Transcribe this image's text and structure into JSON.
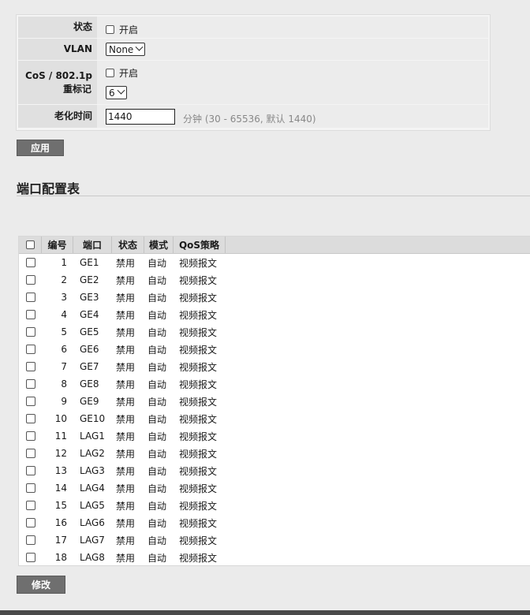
{
  "settings": {
    "status_label": "状态",
    "status_checkbox_text": "开启",
    "vlan_label": "VLAN",
    "vlan_value": "None",
    "cos_label_line1": "CoS / 802.1p",
    "cos_label_line2": "重标记",
    "cos_checkbox_text": "开启",
    "cos_value": "6",
    "aging_label": "老化时间",
    "aging_value": "1440",
    "aging_hint": "分钟 (30 - 65536, 默认 1440)",
    "apply_button": "应用"
  },
  "port_table": {
    "title": "端口配置表",
    "columns": [
      "编号",
      "端口",
      "状态",
      "模式",
      "QoS策略"
    ],
    "rows": [
      {
        "no": "1",
        "port": "GE1",
        "status": "禁用",
        "mode": "自动",
        "qos": "视频报文"
      },
      {
        "no": "2",
        "port": "GE2",
        "status": "禁用",
        "mode": "自动",
        "qos": "视频报文"
      },
      {
        "no": "3",
        "port": "GE3",
        "status": "禁用",
        "mode": "自动",
        "qos": "视频报文"
      },
      {
        "no": "4",
        "port": "GE4",
        "status": "禁用",
        "mode": "自动",
        "qos": "视频报文"
      },
      {
        "no": "5",
        "port": "GE5",
        "status": "禁用",
        "mode": "自动",
        "qos": "视频报文"
      },
      {
        "no": "6",
        "port": "GE6",
        "status": "禁用",
        "mode": "自动",
        "qos": "视频报文"
      },
      {
        "no": "7",
        "port": "GE7",
        "status": "禁用",
        "mode": "自动",
        "qos": "视频报文"
      },
      {
        "no": "8",
        "port": "GE8",
        "status": "禁用",
        "mode": "自动",
        "qos": "视频报文"
      },
      {
        "no": "9",
        "port": "GE9",
        "status": "禁用",
        "mode": "自动",
        "qos": "视频报文"
      },
      {
        "no": "10",
        "port": "GE10",
        "status": "禁用",
        "mode": "自动",
        "qos": "视频报文"
      },
      {
        "no": "11",
        "port": "LAG1",
        "status": "禁用",
        "mode": "自动",
        "qos": "视频报文"
      },
      {
        "no": "12",
        "port": "LAG2",
        "status": "禁用",
        "mode": "自动",
        "qos": "视频报文"
      },
      {
        "no": "13",
        "port": "LAG3",
        "status": "禁用",
        "mode": "自动",
        "qos": "视频报文"
      },
      {
        "no": "14",
        "port": "LAG4",
        "status": "禁用",
        "mode": "自动",
        "qos": "视频报文"
      },
      {
        "no": "15",
        "port": "LAG5",
        "status": "禁用",
        "mode": "自动",
        "qos": "视频报文"
      },
      {
        "no": "16",
        "port": "LAG6",
        "status": "禁用",
        "mode": "自动",
        "qos": "视频报文"
      },
      {
        "no": "17",
        "port": "LAG7",
        "status": "禁用",
        "mode": "自动",
        "qos": "视频报文"
      },
      {
        "no": "18",
        "port": "LAG8",
        "status": "禁用",
        "mode": "自动",
        "qos": "视频报文"
      }
    ],
    "edit_button": "修改"
  }
}
